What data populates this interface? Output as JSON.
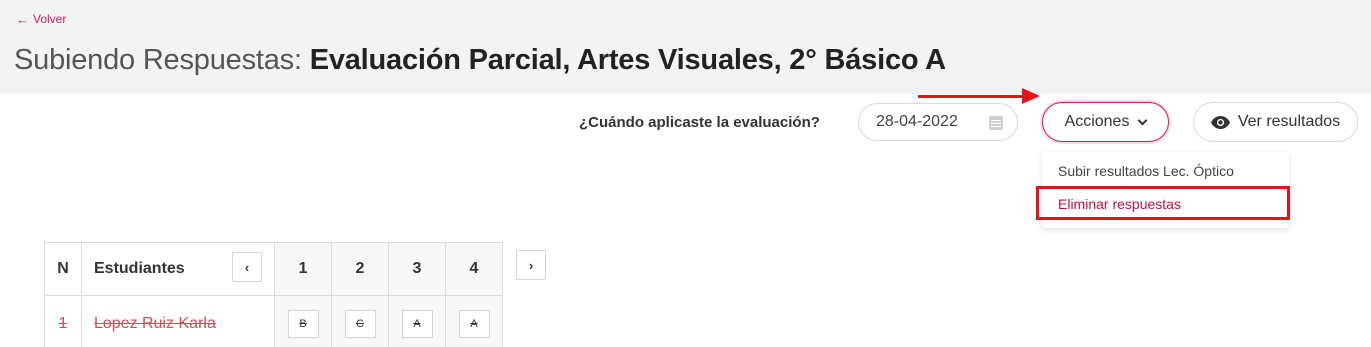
{
  "header": {
    "back_label": "Volver",
    "title_prefix": "Subiendo Respuestas:",
    "title_main": "Evaluación Parcial, Artes Visuales, 2° Básico A"
  },
  "toolbar": {
    "date_question": "¿Cuándo aplicaste la evaluación?",
    "date_value": "28-04-2022",
    "actions_label": "Acciones",
    "results_label": "Ver resultados"
  },
  "dropdown": {
    "items": [
      {
        "label": "Subir resultados Lec. Óptico"
      },
      {
        "label": "Eliminar respuestas"
      }
    ]
  },
  "table": {
    "headers": {
      "n": "N",
      "students": "Estudiantes",
      "questions": [
        "1",
        "2",
        "3",
        "4"
      ]
    },
    "rows": [
      {
        "n": "1",
        "name": "Lopez Ruiz Karla",
        "answers": [
          "B",
          "C",
          "A",
          "A"
        ]
      }
    ]
  },
  "colors": {
    "accent": "#d11a5c",
    "annotation_red": "#e3131b",
    "header_bg": "#f3f3f3"
  },
  "icons": {
    "back": "arrow-left-icon",
    "calendar": "calendar-icon",
    "chevron": "chevron-down-icon",
    "eye": "eye-icon",
    "prev": "chevron-left-icon",
    "next": "chevron-right-icon"
  }
}
